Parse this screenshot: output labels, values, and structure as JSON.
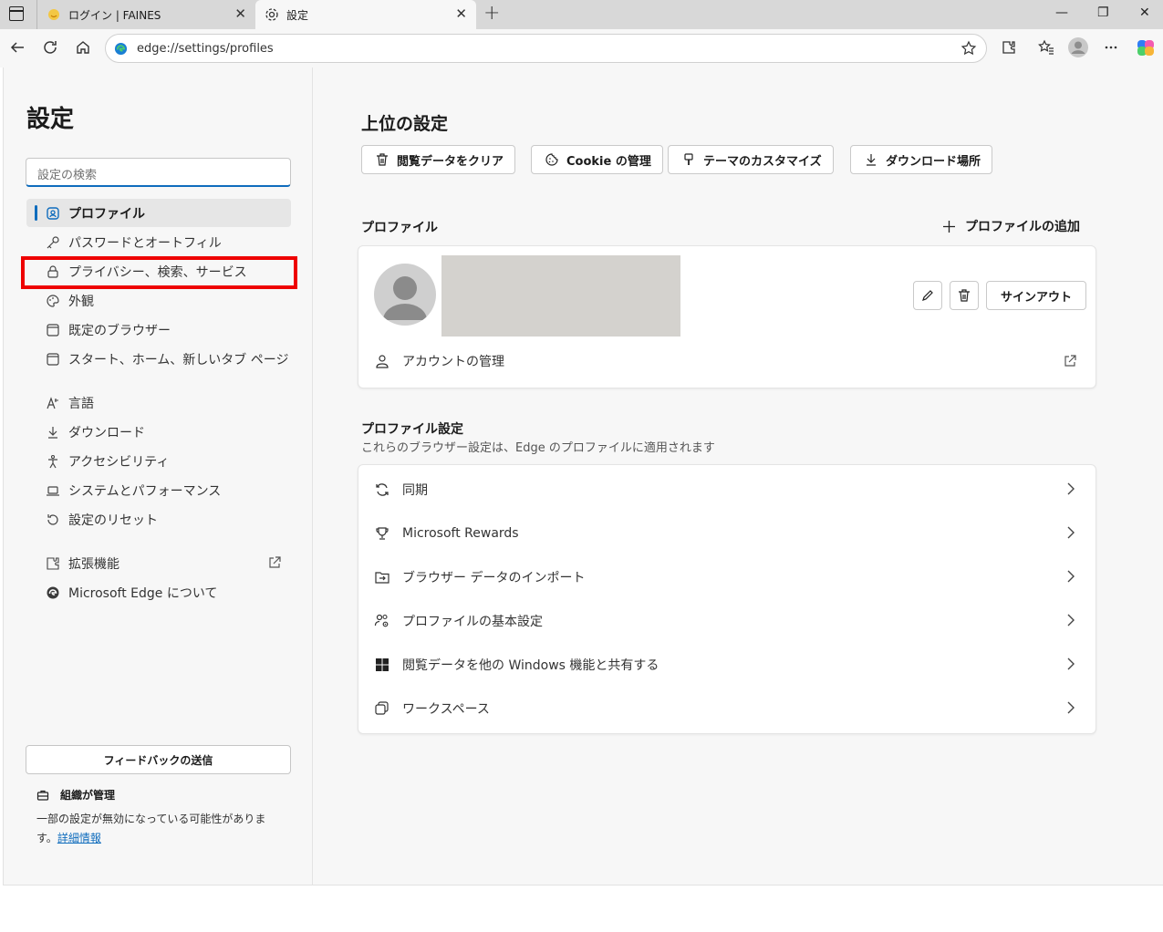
{
  "browser": {
    "tabs": [
      {
        "title": "ログイン | FAINES",
        "close": "✕"
      },
      {
        "title": "設定",
        "close": "✕"
      }
    ],
    "new_tab": "+",
    "window_controls": {
      "minimize": "—",
      "restore": "❐",
      "close": "✕"
    },
    "url": "edge://settings/profiles"
  },
  "sidebar": {
    "title": "設定",
    "search_placeholder": "設定の検索",
    "items": [
      {
        "label": "プロファイル",
        "icon": "profile-icon",
        "active": true
      },
      {
        "label": "パスワードとオートフィル",
        "icon": "key-icon"
      },
      {
        "label": "プライバシー、検索、サービス",
        "icon": "lock-icon"
      },
      {
        "label": "外観",
        "icon": "palette-icon"
      },
      {
        "label": "既定のブラウザー",
        "icon": "browser-icon"
      },
      {
        "label": "スタート、ホーム、新しいタブ ページ",
        "icon": "home-window-icon"
      },
      {
        "label": "言語",
        "icon": "language-icon"
      },
      {
        "label": "ダウンロード",
        "icon": "download-icon"
      },
      {
        "label": "アクセシビリティ",
        "icon": "accessibility-icon"
      },
      {
        "label": "システムとパフォーマンス",
        "icon": "laptop-icon"
      },
      {
        "label": "設定のリセット",
        "icon": "reset-icon"
      },
      {
        "label": "拡張機能",
        "icon": "extensions-icon"
      },
      {
        "label": "Microsoft Edge について",
        "icon": "edge-icon"
      }
    ],
    "feedback_label": "フィードバックの送信",
    "managed_label": "組織が管理",
    "managed_text": "一部の設定が無効になっている可能性がありま す。",
    "managed_link": "詳細情報"
  },
  "main": {
    "title": "上位の設定",
    "quick_buttons": [
      {
        "label": "閲覧データをクリア",
        "icon": "trash-icon"
      },
      {
        "label": "Cookie の管理",
        "icon": "cookie-icon"
      },
      {
        "label": "テーマのカスタマイズ",
        "icon": "brush-icon"
      },
      {
        "label": "ダウンロード場所",
        "icon": "download-icon"
      }
    ],
    "profile_section_title": "プロファイル",
    "add_profile_label": "プロファイルの追加",
    "signout_label": "サインアウト",
    "manage_account_label": "アカウントの管理",
    "profile_settings_title": "プロファイル設定",
    "profile_settings_subtitle": "これらのブラウザー設定は、Edge のプロファイルに適用されます",
    "settings_rows": [
      {
        "label": "同期",
        "icon": "sync-icon"
      },
      {
        "label": "Microsoft Rewards",
        "icon": "trophy-icon"
      },
      {
        "label": "ブラウザー データのインポート",
        "icon": "import-icon"
      },
      {
        "label": "プロファイルの基本設定",
        "icon": "people-settings-icon"
      },
      {
        "label": "閲覧データを他の Windows 機能と共有する",
        "icon": "windows-icon"
      },
      {
        "label": "ワークスペース",
        "icon": "workspaces-icon"
      }
    ]
  },
  "colors": {
    "accent": "#0f6cbd",
    "highlight": "#ee0000"
  }
}
